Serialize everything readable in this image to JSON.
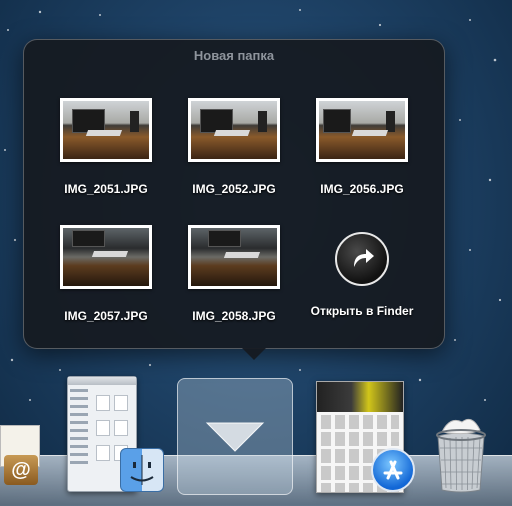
{
  "stack": {
    "title": "Новая папка",
    "items": [
      {
        "label": "IMG_2051.JPG",
        "icon": "photo-thumbnail"
      },
      {
        "label": "IMG_2052.JPG",
        "icon": "photo-thumbnail"
      },
      {
        "label": "IMG_2056.JPG",
        "icon": "photo-thumbnail"
      },
      {
        "label": "IMG_2057.JPG",
        "icon": "photo-thumbnail"
      },
      {
        "label": "IMG_2058.JPG",
        "icon": "photo-thumbnail"
      }
    ],
    "open_in_finder": {
      "label": "Открыть в Finder",
      "icon": "arrow-circle-icon"
    }
  },
  "dock": {
    "items": [
      {
        "name": "contacts",
        "icon": "address-book-icon"
      },
      {
        "name": "finder",
        "icon": "finder-icon"
      },
      {
        "name": "downloads-stack",
        "icon": "down-arrow-icon"
      },
      {
        "name": "app-store",
        "icon": "app-store-icon"
      },
      {
        "name": "trash",
        "icon": "trash-icon"
      }
    ]
  },
  "colors": {
    "popup_bg": "#161a20",
    "title_text": "#8e949c",
    "label_text": "#ffffff",
    "desktop": "#1e4266"
  }
}
